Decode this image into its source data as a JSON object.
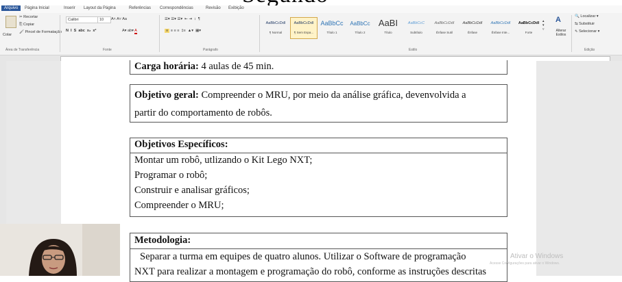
{
  "doc_title_fragment": "Segundo",
  "ribbon": {
    "tabs": [
      "Arquivo",
      "Página Inicial",
      "Inserir",
      "Layout da Página",
      "Referências",
      "Correspondências",
      "Revisão",
      "Exibição"
    ],
    "clipboard": {
      "paste": "Colar",
      "cut": "Recortar",
      "copy": "Copiar",
      "format_painter": "Pincel de Formatação",
      "group_label": "Área de Transferência"
    },
    "font": {
      "name": "Calibri",
      "size": "10",
      "group_label": "Fonte"
    },
    "paragraph": {
      "group_label": "Parágrafo"
    },
    "styles": {
      "group_label": "Estilo",
      "items": [
        {
          "sample": "AaBbCcDdI",
          "name": "¶ Normal"
        },
        {
          "sample": "AaBbCcDdI",
          "name": "¶ Sem Espa..."
        },
        {
          "sample": "AaBbCc",
          "name": "Título 1"
        },
        {
          "sample": "AaBbCc",
          "name": "Título 2"
        },
        {
          "sample": "AaBI",
          "name": "Título"
        },
        {
          "sample": "AaBbCcC",
          "name": "Subtítulo"
        },
        {
          "sample": "AaBbCcDdI",
          "name": "Ênfase Sutil"
        },
        {
          "sample": "AaBbCcDdI",
          "name": "Ênfase"
        },
        {
          "sample": "AaBbCcDdI",
          "name": "Ênfase Inte..."
        },
        {
          "sample": "AaBbCcDdI",
          "name": "Forte"
        }
      ],
      "change_styles": "Alterar Estilos"
    },
    "editing": {
      "find": "Localizar",
      "replace": "Substituir",
      "select": "Selecionar",
      "group_label": "Edição"
    }
  },
  "document": {
    "carga": {
      "label": "Carga horária:",
      "value": "4 aulas de 45 min."
    },
    "objetivo_geral": {
      "label": "Objetivo geral:",
      "line1": "Compreender o MRU, por meio da análise gráfica, devenvolvida a",
      "line2": "partir do comportamento de robôs."
    },
    "objetivos_especificos": {
      "label": "Objetivos Específicos:",
      "items": [
        "Montar um robô, utlizando o Kit Lego NXT;",
        "Programar o robô;",
        "Construir e analisar gráficos;",
        "Compreender o MRU;"
      ]
    },
    "metodologia": {
      "label": "Metodologia:",
      "line1": "Separar a turma em equipes de quatro alunos. Utilizar o Software de programação",
      "line2": "NXT para realizar a montagem e programação do robô, conforme as instruções descritas"
    }
  },
  "watermark": {
    "line1": "Ativar o Windows",
    "line2": "Acesse Configurações para ativar o Windows."
  }
}
